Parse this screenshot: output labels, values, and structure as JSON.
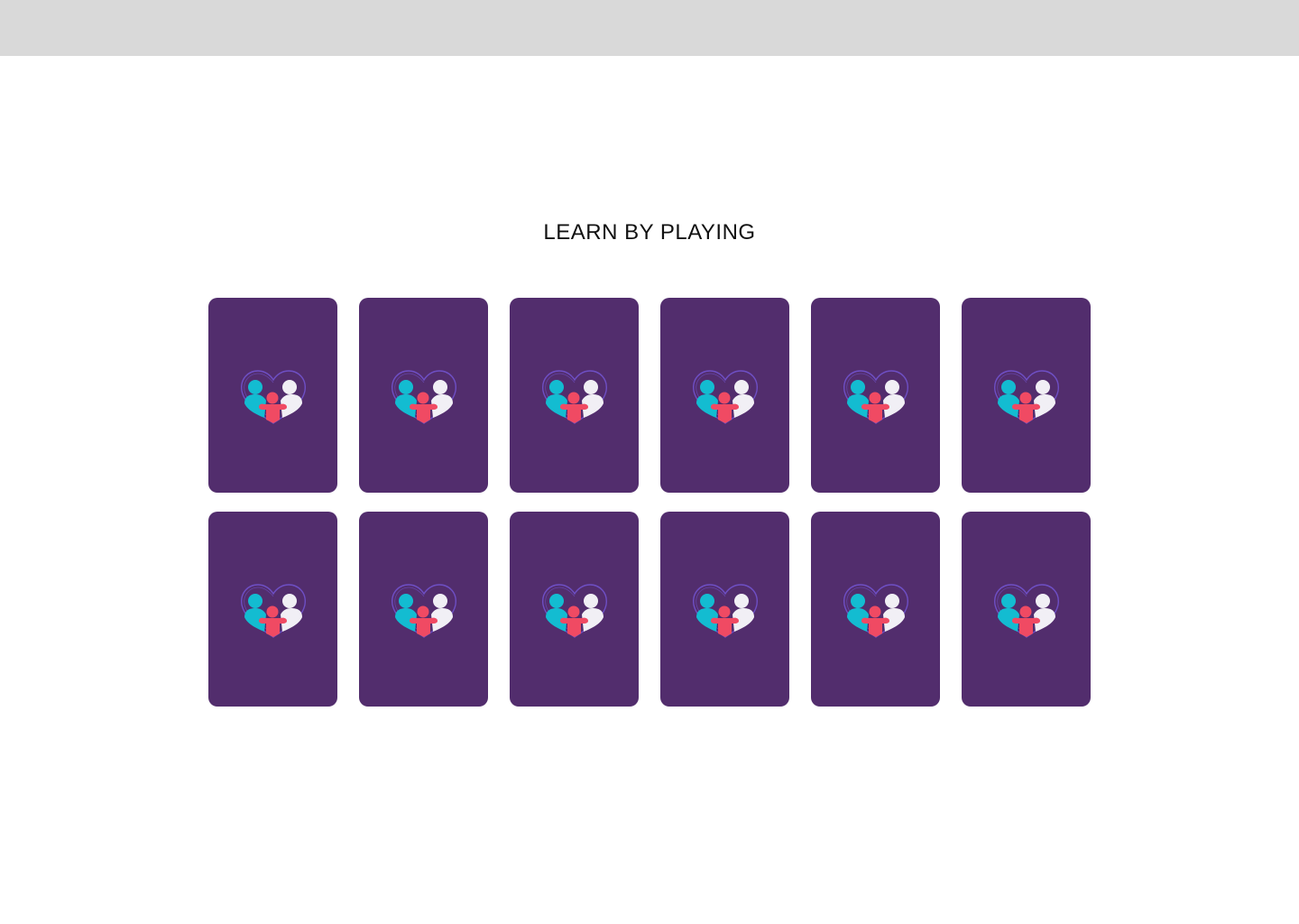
{
  "title": "LEARN BY PLAYING",
  "colors": {
    "top_bar": "#d9d9d9",
    "card_back": "#522d6d",
    "logo_teal": "#13bcd1",
    "logo_red": "#f04a63",
    "logo_white": "#f1eff5",
    "logo_outline": "#6e4fc4"
  },
  "board": {
    "rows": 2,
    "columns": 6,
    "cards": [
      {
        "state": "face-down",
        "icon": "family-heart-logo"
      },
      {
        "state": "face-down",
        "icon": "family-heart-logo"
      },
      {
        "state": "face-down",
        "icon": "family-heart-logo"
      },
      {
        "state": "face-down",
        "icon": "family-heart-logo"
      },
      {
        "state": "face-down",
        "icon": "family-heart-logo"
      },
      {
        "state": "face-down",
        "icon": "family-heart-logo"
      },
      {
        "state": "face-down",
        "icon": "family-heart-logo"
      },
      {
        "state": "face-down",
        "icon": "family-heart-logo"
      },
      {
        "state": "face-down",
        "icon": "family-heart-logo"
      },
      {
        "state": "face-down",
        "icon": "family-heart-logo"
      },
      {
        "state": "face-down",
        "icon": "family-heart-logo"
      },
      {
        "state": "face-down",
        "icon": "family-heart-logo"
      }
    ]
  }
}
